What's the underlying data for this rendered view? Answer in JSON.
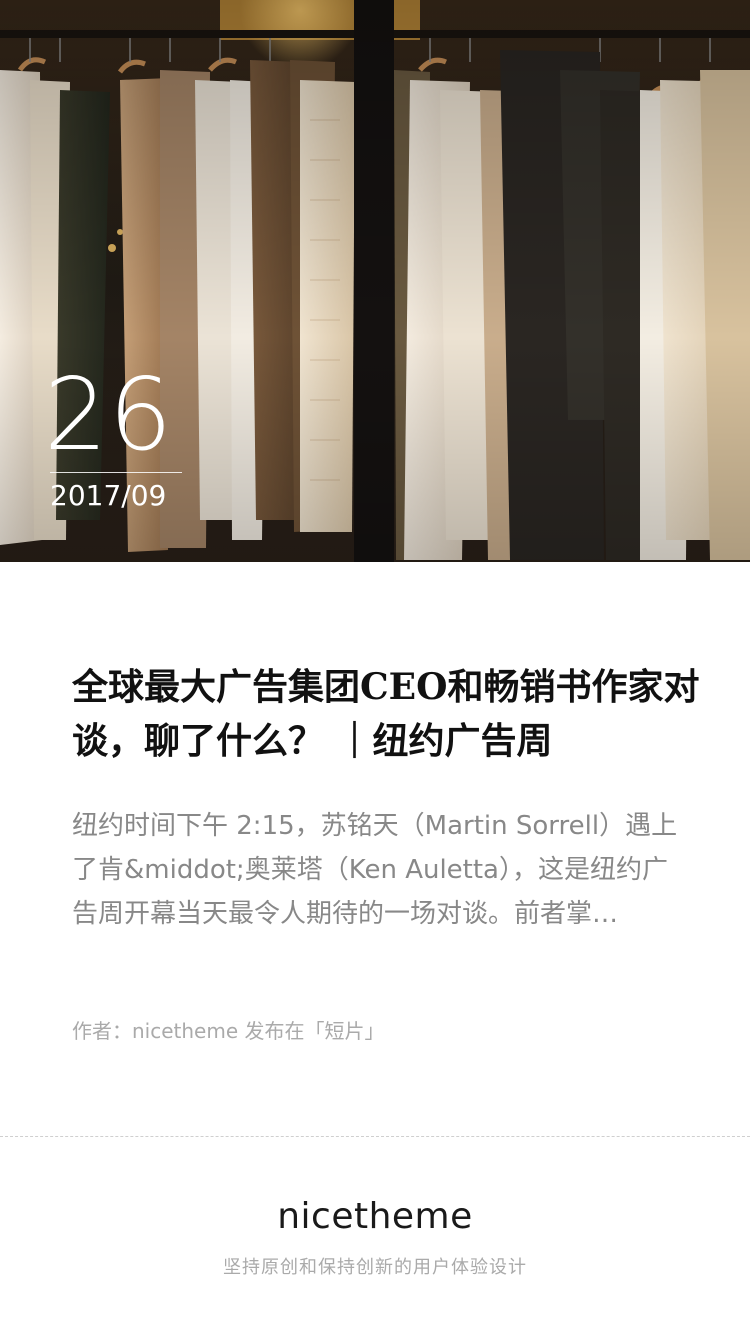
{
  "hero": {
    "day": "26",
    "month": "2017/09"
  },
  "article": {
    "title": "全球最大广告集团CEO和畅销书作家对谈，聊了什么？ ｜纽约广告周",
    "excerpt": "纽约时间下午 2:15，苏铭天（Martin Sorrell）遇上了肯&middot;奥莱塔（Ken Auletta），这是纽约广告周开幕当天最令人期待的一场对谈。前者掌…",
    "meta": "作者：nicetheme 发布在「短片」"
  },
  "footer": {
    "logo": "nicetheme",
    "slogan": "坚持原创和保持创新的用户体验设计"
  },
  "colors": {
    "title": "#111111",
    "excerpt": "#888888",
    "meta": "#aaaaaa",
    "divider": "#cfcfcf"
  }
}
